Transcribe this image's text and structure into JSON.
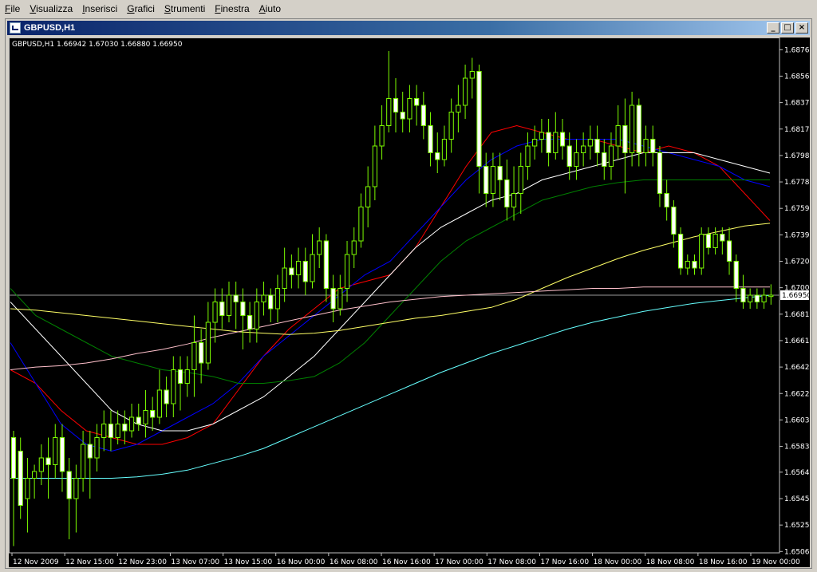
{
  "menubar": {
    "items": [
      {
        "label": "File"
      },
      {
        "label": "Visualizza"
      },
      {
        "label": "Inserisci"
      },
      {
        "label": "Grafici"
      },
      {
        "label": "Strumenti"
      },
      {
        "label": "Finestra"
      },
      {
        "label": "Aiuto"
      }
    ]
  },
  "window": {
    "title": "GBPUSD,H1",
    "buttons": {
      "minimize": "_",
      "restore": "□",
      "close": "×"
    }
  },
  "chart_data": {
    "type": "candlestick",
    "title": "GBPUSD,H1 1.66942 1.67030 1.66880 1.66950",
    "current_price_label": "1.66950",
    "ylim": [
      1.6505,
      1.6885
    ],
    "y_ticks": [
      "1.68760",
      "1.68565",
      "1.68370",
      "1.68175",
      "1.67980",
      "1.67785",
      "1.67590",
      "1.67395",
      "1.67200",
      "1.67005",
      "1.66810",
      "1.66615",
      "1.66420",
      "1.66225",
      "1.66030",
      "1.65835",
      "1.65645",
      "1.65450",
      "1.65255",
      "1.65060"
    ],
    "x_ticks": [
      "12 Nov 2009",
      "12 Nov 15:00",
      "12 Nov 23:00",
      "13 Nov 07:00",
      "13 Nov 15:00",
      "16 Nov 00:00",
      "16 Nov 08:00",
      "16 Nov 16:00",
      "17 Nov 00:00",
      "17 Nov 08:00",
      "17 Nov 16:00",
      "18 Nov 00:00",
      "18 Nov 08:00",
      "18 Nov 16:00",
      "19 Nov 00:00"
    ],
    "candles": [
      [
        1.659,
        1.656,
        1.651,
        1.6595
      ],
      [
        1.658,
        1.654,
        1.653,
        1.659
      ],
      [
        1.6545,
        1.656,
        1.652,
        1.6575
      ],
      [
        1.656,
        1.6565,
        1.6545,
        1.657
      ],
      [
        1.6565,
        1.6575,
        1.6555,
        1.6585
      ],
      [
        1.6575,
        1.657,
        1.6545,
        1.659
      ],
      [
        1.657,
        1.659,
        1.656,
        1.66
      ],
      [
        1.659,
        1.6565,
        1.655,
        1.66
      ],
      [
        1.6565,
        1.6545,
        1.6515,
        1.6575
      ],
      [
        1.6545,
        1.656,
        1.652,
        1.657
      ],
      [
        1.656,
        1.6585,
        1.655,
        1.6595
      ],
      [
        1.6585,
        1.6575,
        1.6545,
        1.6595
      ],
      [
        1.6575,
        1.659,
        1.6565,
        1.66
      ],
      [
        1.659,
        1.66,
        1.658,
        1.661
      ],
      [
        1.66,
        1.659,
        1.658,
        1.661
      ],
      [
        1.659,
        1.66,
        1.6585,
        1.661
      ],
      [
        1.66,
        1.6595,
        1.6585,
        1.661
      ],
      [
        1.6595,
        1.6605,
        1.659,
        1.6615
      ],
      [
        1.6605,
        1.66,
        1.6595,
        1.6615
      ],
      [
        1.66,
        1.661,
        1.659,
        1.6625
      ],
      [
        1.661,
        1.6605,
        1.6595,
        1.662
      ],
      [
        1.6605,
        1.6625,
        1.66,
        1.664
      ],
      [
        1.6625,
        1.6615,
        1.6605,
        1.6635
      ],
      [
        1.6615,
        1.664,
        1.6605,
        1.665
      ],
      [
        1.664,
        1.663,
        1.661,
        1.665
      ],
      [
        1.663,
        1.664,
        1.662,
        1.665
      ],
      [
        1.664,
        1.666,
        1.662,
        1.668
      ],
      [
        1.666,
        1.6645,
        1.663,
        1.667
      ],
      [
        1.6645,
        1.6675,
        1.664,
        1.669
      ],
      [
        1.6675,
        1.669,
        1.666,
        1.67
      ],
      [
        1.669,
        1.668,
        1.667,
        1.67
      ],
      [
        1.668,
        1.6695,
        1.6675,
        1.6705
      ],
      [
        1.6695,
        1.669,
        1.667,
        1.6705
      ],
      [
        1.669,
        1.668,
        1.6655,
        1.67
      ],
      [
        1.668,
        1.667,
        1.666,
        1.669
      ],
      [
        1.667,
        1.669,
        1.666,
        1.67
      ],
      [
        1.669,
        1.6695,
        1.668,
        1.6705
      ],
      [
        1.6695,
        1.6685,
        1.6675,
        1.67
      ],
      [
        1.6685,
        1.67,
        1.6675,
        1.671
      ],
      [
        1.67,
        1.6715,
        1.669,
        1.673
      ],
      [
        1.6715,
        1.671,
        1.67,
        1.6725
      ],
      [
        1.671,
        1.672,
        1.67,
        1.673
      ],
      [
        1.672,
        1.6705,
        1.6695,
        1.673
      ],
      [
        1.6705,
        1.6725,
        1.67,
        1.674
      ],
      [
        1.6725,
        1.6735,
        1.6715,
        1.6745
      ],
      [
        1.6735,
        1.67,
        1.669,
        1.674
      ],
      [
        1.67,
        1.6685,
        1.6675,
        1.671
      ],
      [
        1.6685,
        1.67,
        1.668,
        1.671
      ],
      [
        1.67,
        1.6725,
        1.669,
        1.6735
      ],
      [
        1.6725,
        1.6735,
        1.6715,
        1.6745
      ],
      [
        1.6735,
        1.676,
        1.673,
        1.677
      ],
      [
        1.676,
        1.6775,
        1.6745,
        1.679
      ],
      [
        1.6775,
        1.6805,
        1.6765,
        1.682
      ],
      [
        1.6805,
        1.682,
        1.6795,
        1.6835
      ],
      [
        1.682,
        1.684,
        1.6815,
        1.6875
      ],
      [
        1.684,
        1.683,
        1.6815,
        1.6855
      ],
      [
        1.683,
        1.6825,
        1.6815,
        1.6845
      ],
      [
        1.6825,
        1.684,
        1.6815,
        1.685
      ],
      [
        1.684,
        1.6835,
        1.682,
        1.685
      ],
      [
        1.6835,
        1.682,
        1.681,
        1.6845
      ],
      [
        1.682,
        1.68,
        1.679,
        1.683
      ],
      [
        1.68,
        1.6795,
        1.6785,
        1.6815
      ],
      [
        1.6795,
        1.681,
        1.679,
        1.682
      ],
      [
        1.681,
        1.683,
        1.68,
        1.684
      ],
      [
        1.683,
        1.6835,
        1.6815,
        1.685
      ],
      [
        1.6835,
        1.6855,
        1.6825,
        1.6865
      ],
      [
        1.6855,
        1.686,
        1.684,
        1.687
      ],
      [
        1.686,
        1.679,
        1.677,
        1.6865
      ],
      [
        1.679,
        1.677,
        1.676,
        1.68
      ],
      [
        1.677,
        1.679,
        1.676,
        1.68
      ],
      [
        1.679,
        1.678,
        1.6765,
        1.68
      ],
      [
        1.678,
        1.676,
        1.675,
        1.6795
      ],
      [
        1.676,
        1.677,
        1.675,
        1.679
      ],
      [
        1.677,
        1.679,
        1.6755,
        1.68
      ],
      [
        1.679,
        1.6805,
        1.678,
        1.6815
      ],
      [
        1.6805,
        1.681,
        1.6795,
        1.682
      ],
      [
        1.681,
        1.6815,
        1.68,
        1.6825
      ],
      [
        1.6815,
        1.68,
        1.679,
        1.6825
      ],
      [
        1.68,
        1.6815,
        1.6795,
        1.683
      ],
      [
        1.6815,
        1.6805,
        1.6795,
        1.6825
      ],
      [
        1.6805,
        1.679,
        1.678,
        1.6815
      ],
      [
        1.679,
        1.68,
        1.678,
        1.681
      ],
      [
        1.68,
        1.6805,
        1.679,
        1.6815
      ],
      [
        1.6805,
        1.681,
        1.6795,
        1.682
      ],
      [
        1.681,
        1.68,
        1.679,
        1.682
      ],
      [
        1.68,
        1.679,
        1.678,
        1.681
      ],
      [
        1.679,
        1.6805,
        1.678,
        1.6815
      ],
      [
        1.6805,
        1.682,
        1.6795,
        1.6835
      ],
      [
        1.682,
        1.68,
        1.677,
        1.684
      ],
      [
        1.68,
        1.6835,
        1.679,
        1.6845
      ],
      [
        1.6835,
        1.68,
        1.679,
        1.684
      ],
      [
        1.68,
        1.681,
        1.679,
        1.682
      ],
      [
        1.681,
        1.68,
        1.679,
        1.682
      ],
      [
        1.68,
        1.677,
        1.676,
        1.6805
      ],
      [
        1.677,
        1.676,
        1.675,
        1.678
      ],
      [
        1.676,
        1.674,
        1.673,
        1.6765
      ],
      [
        1.674,
        1.6715,
        1.671,
        1.6745
      ],
      [
        1.6715,
        1.672,
        1.671,
        1.6725
      ],
      [
        1.672,
        1.6715,
        1.671,
        1.6725
      ],
      [
        1.6715,
        1.674,
        1.671,
        1.6745
      ],
      [
        1.674,
        1.673,
        1.6725,
        1.6745
      ],
      [
        1.673,
        1.674,
        1.6725,
        1.6745
      ],
      [
        1.674,
        1.6735,
        1.6725,
        1.6745
      ],
      [
        1.6735,
        1.672,
        1.671,
        1.6745
      ],
      [
        1.672,
        1.67,
        1.669,
        1.6725
      ],
      [
        1.67,
        1.669,
        1.6685,
        1.671
      ],
      [
        1.669,
        1.6695,
        1.6685,
        1.67
      ],
      [
        1.6695,
        1.669,
        1.6685,
        1.67
      ],
      [
        1.669,
        1.6695,
        1.6685,
        1.67
      ],
      [
        1.6694,
        1.6695,
        1.6688,
        1.6703
      ]
    ],
    "series": [
      {
        "color": "#ff0000",
        "values": [
          1.664,
          1.663,
          1.661,
          1.6595,
          1.659,
          1.6585,
          1.6585,
          1.659,
          1.66,
          1.6625,
          1.665,
          1.667,
          1.6685,
          1.67,
          1.6705,
          1.671,
          1.673,
          1.676,
          1.679,
          1.6815,
          1.682,
          1.6815,
          1.681,
          1.681,
          1.6805,
          1.68,
          1.6805,
          1.68,
          1.679,
          1.677,
          1.675
        ]
      },
      {
        "color": "#0000ff",
        "values": [
          1.666,
          1.663,
          1.66,
          1.6585,
          1.658,
          1.6585,
          1.6595,
          1.6605,
          1.6615,
          1.663,
          1.665,
          1.6665,
          1.668,
          1.6695,
          1.671,
          1.672,
          1.674,
          1.676,
          1.678,
          1.6795,
          1.6805,
          1.681,
          1.681,
          1.681,
          1.681,
          1.6805,
          1.68,
          1.6795,
          1.679,
          1.678,
          1.6775
        ]
      },
      {
        "color": "#ffffff",
        "values": [
          1.669,
          1.667,
          1.665,
          1.663,
          1.661,
          1.66,
          1.6595,
          1.6595,
          1.66,
          1.661,
          1.662,
          1.6635,
          1.665,
          1.667,
          1.669,
          1.671,
          1.673,
          1.6745,
          1.6755,
          1.6765,
          1.677,
          1.678,
          1.6785,
          1.679,
          1.6795,
          1.68,
          1.68,
          1.68,
          1.6795,
          1.679,
          1.6785
        ]
      },
      {
        "color": "#008000",
        "values": [
          1.67,
          1.668,
          1.667,
          1.666,
          1.665,
          1.6645,
          1.664,
          1.6638,
          1.6635,
          1.663,
          1.663,
          1.6632,
          1.6635,
          1.6645,
          1.666,
          1.668,
          1.67,
          1.672,
          1.6735,
          1.6745,
          1.6755,
          1.6765,
          1.677,
          1.6775,
          1.6778,
          1.678,
          1.678,
          1.678,
          1.678,
          1.678,
          1.678
        ]
      },
      {
        "color": "#ffff66",
        "values": [
          1.6685,
          1.6684,
          1.6682,
          1.668,
          1.6678,
          1.6676,
          1.6674,
          1.6672,
          1.667,
          1.6668,
          1.6667,
          1.6666,
          1.6667,
          1.6669,
          1.6672,
          1.6675,
          1.6678,
          1.668,
          1.6683,
          1.6686,
          1.6692,
          1.67,
          1.6708,
          1.6715,
          1.6722,
          1.6728,
          1.6733,
          1.6738,
          1.6742,
          1.6746,
          1.6748
        ]
      },
      {
        "color": "#ffc0cb",
        "values": [
          1.664,
          1.6642,
          1.6643,
          1.6645,
          1.6648,
          1.6652,
          1.6655,
          1.6659,
          1.6664,
          1.6668,
          1.6672,
          1.6676,
          1.668,
          1.6684,
          1.6687,
          1.669,
          1.6692,
          1.6694,
          1.6695,
          1.6696,
          1.6697,
          1.6698,
          1.6699,
          1.67,
          1.67,
          1.6701,
          1.6701,
          1.6701,
          1.6701,
          1.6701,
          1.6701
        ]
      },
      {
        "color": "#66ffff",
        "values": [
          1.656,
          1.656,
          1.656,
          1.656,
          1.656,
          1.6561,
          1.6563,
          1.6566,
          1.6571,
          1.6576,
          1.6582,
          1.659,
          1.6598,
          1.6606,
          1.6614,
          1.6622,
          1.663,
          1.6638,
          1.6645,
          1.6652,
          1.6658,
          1.6664,
          1.667,
          1.6675,
          1.6679,
          1.6683,
          1.6686,
          1.6689,
          1.6691,
          1.6693,
          1.6695
        ]
      }
    ]
  }
}
